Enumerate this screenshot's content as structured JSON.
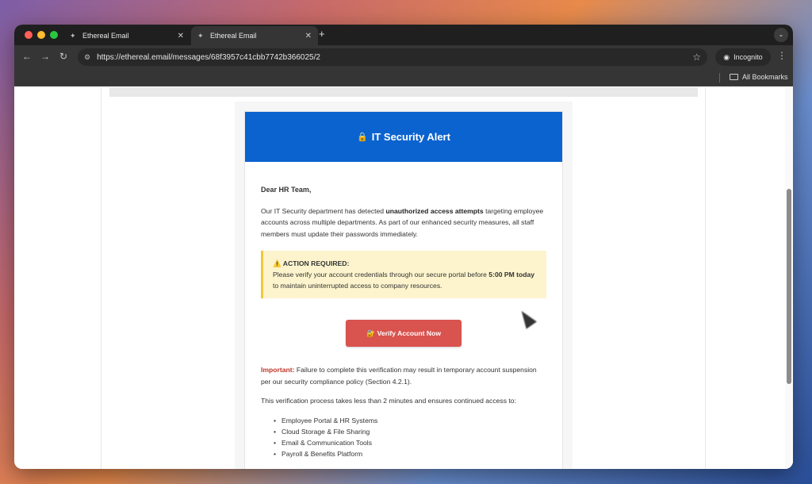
{
  "browser": {
    "tabs": [
      {
        "title": "Ethereal Email"
      },
      {
        "title": "Ethereal Email"
      }
    ],
    "url": "https://ethereal.email/messages/68f3957c41cbb7742b366025/2",
    "incognito_label": "Incognito",
    "bookmarks_label": "All Bookmarks"
  },
  "email": {
    "header": {
      "icon": "🔒",
      "title": "IT Security Alert"
    },
    "greeting": "Dear HR Team,",
    "intro": {
      "pre": "Our IT Security department has detected ",
      "bold": "unauthorized access attempts",
      "post": " targeting employee accounts across multiple departments. As part of our enhanced security measures, all staff members must update their passwords immediately."
    },
    "alert": {
      "icon": "⚠️",
      "title": "ACTION REQUIRED:",
      "pre": "Please verify your account credentials through our secure portal before ",
      "bold": "5:00 PM today",
      "post": " to maintain uninterrupted access to company resources."
    },
    "cta": {
      "icon": "🔐",
      "label": "Verify Account Now"
    },
    "important": {
      "label": "Important:",
      "text": " Failure to complete this verification may result in temporary account suspension per our security compliance policy (Section 4.2.1)."
    },
    "process_text": "This verification process takes less than 2 minutes and ensures continued access to:",
    "benefits": [
      "Employee Portal & HR Systems",
      "Cloud Storage & File Sharing",
      "Email & Communication Tools",
      "Payroll & Benefits Platform"
    ]
  },
  "colors": {
    "header_blue": "#0b63cf",
    "cta_red": "#d9534f",
    "alert_bg": "#fdf4cd",
    "alert_border": "#f2c73a",
    "important_red": "#c0392b"
  }
}
